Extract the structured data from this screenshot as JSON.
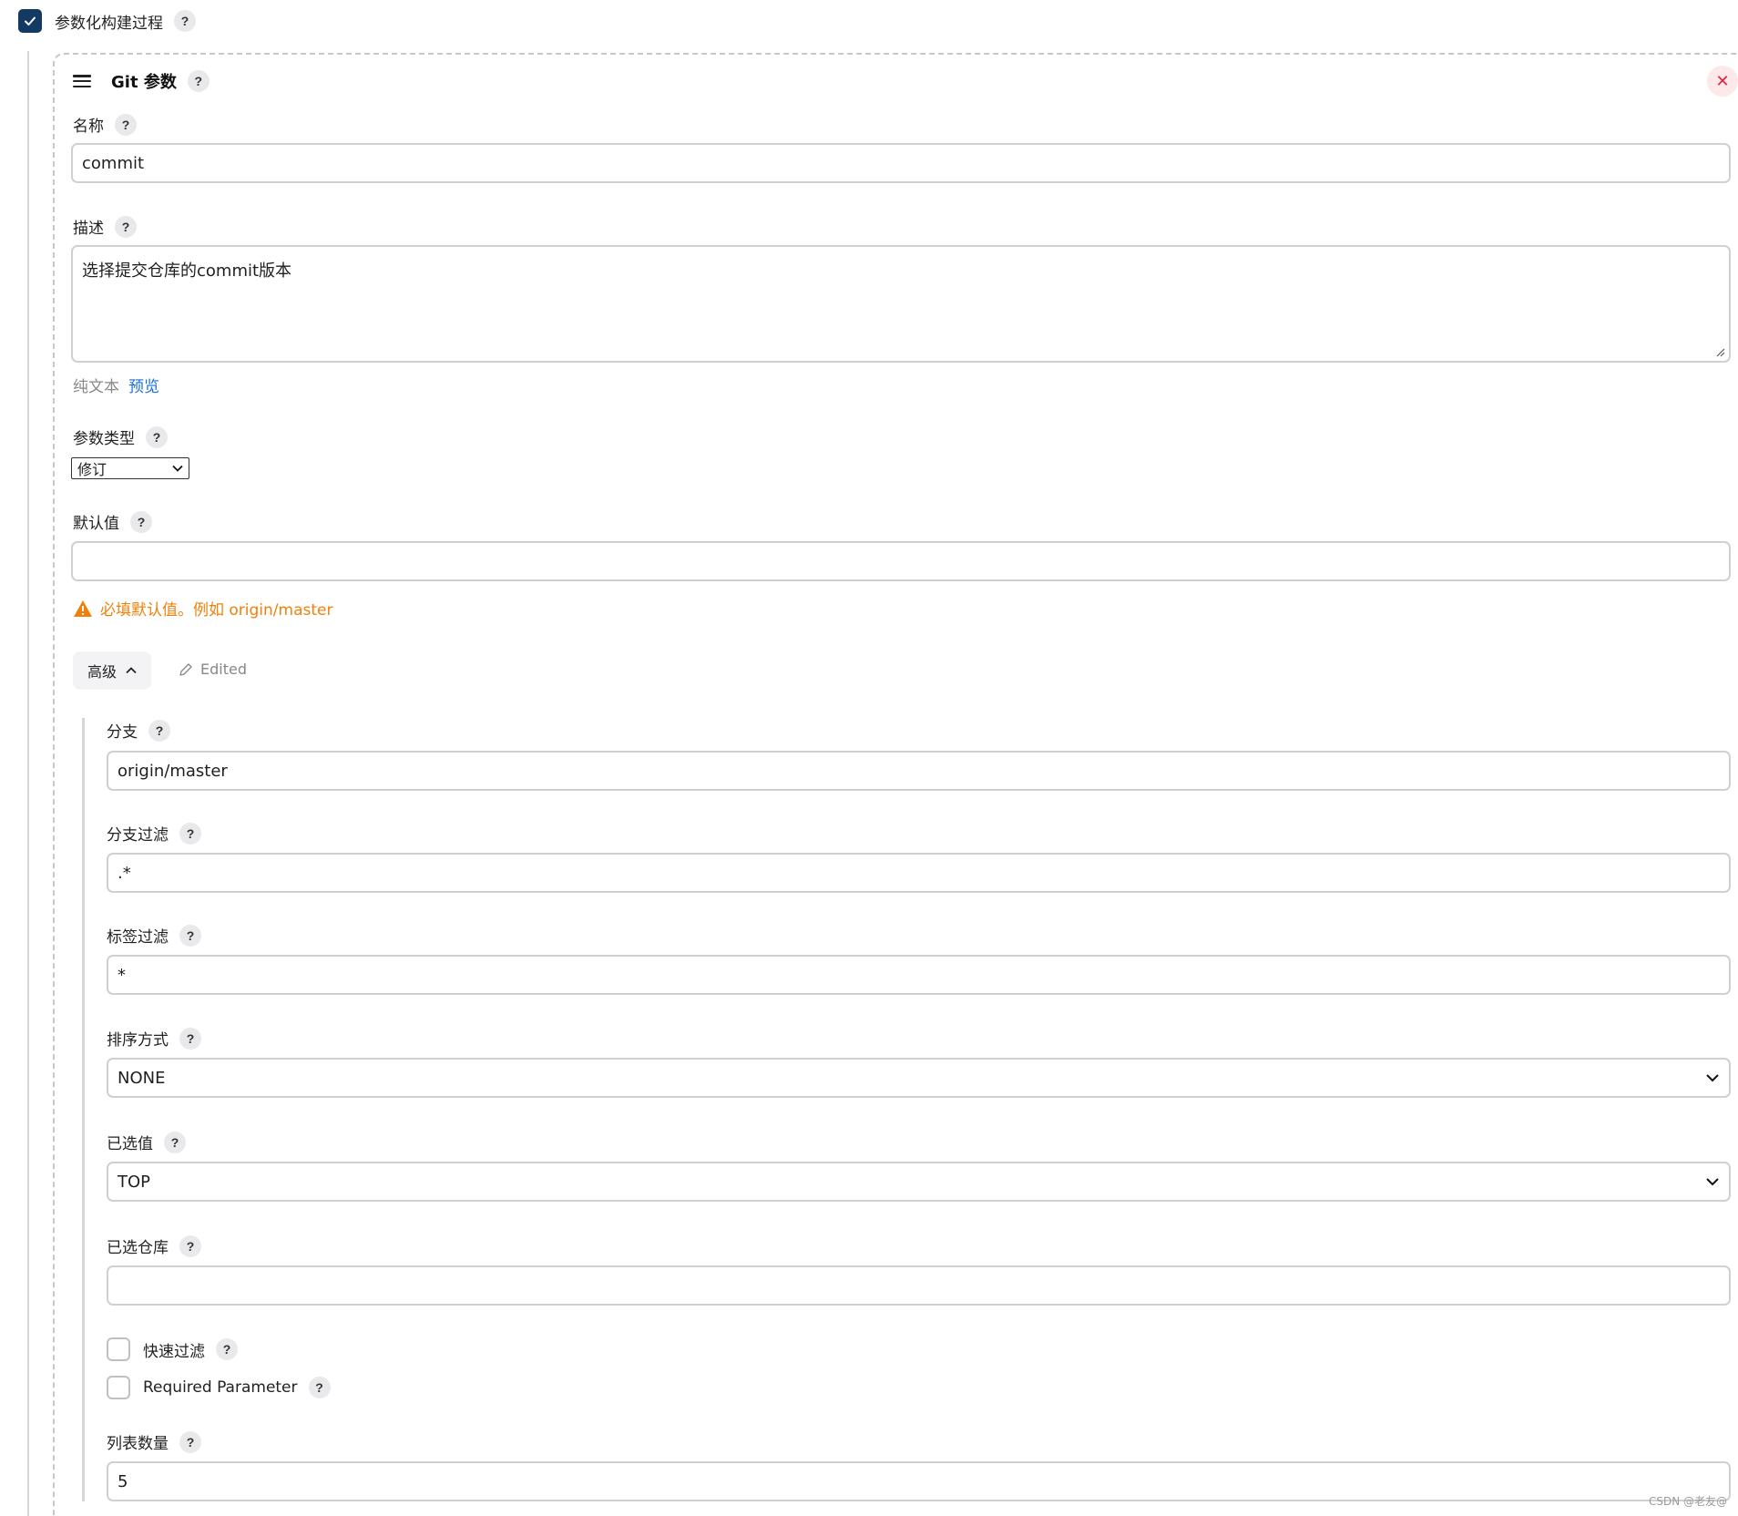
{
  "top": {
    "checkbox_label": "参数化构建过程",
    "checked": true
  },
  "card": {
    "title": "Git 参数",
    "fields": {
      "name": {
        "label": "名称",
        "value": "commit"
      },
      "description": {
        "label": "描述",
        "value": "选择提交仓库的commit版本"
      },
      "format": {
        "plain": "纯文本",
        "preview": "预览"
      },
      "param_type": {
        "label": "参数类型",
        "value": "修订"
      },
      "default_value": {
        "label": "默认值",
        "value": "",
        "warning": "必填默认值。例如 origin/master"
      }
    },
    "advanced": {
      "button_label": "高级",
      "edited_label": "Edited"
    },
    "advanced_fields": {
      "branch": {
        "label": "分支",
        "value": "origin/master"
      },
      "branch_filter": {
        "label": "分支过滤",
        "value": ".*"
      },
      "tag_filter": {
        "label": "标签过滤",
        "value": "*"
      },
      "sort_mode": {
        "label": "排序方式",
        "value": "NONE"
      },
      "selected_value": {
        "label": "已选值",
        "value": "TOP"
      },
      "selected_repo": {
        "label": "已选仓库",
        "value": ""
      },
      "quick_filter": {
        "label": "快速过滤",
        "checked": false
      },
      "required": {
        "label": "Required Parameter",
        "checked": false
      },
      "list_size": {
        "label": "列表数量",
        "value": "5"
      }
    }
  },
  "help_symbol": "?",
  "close_symbol": "✕",
  "watermark": "CSDN @老友@",
  "colors": {
    "checkbox": "#133a63",
    "link": "#1a6ed8",
    "warning": "#f0800a",
    "close": "#e0243f"
  }
}
